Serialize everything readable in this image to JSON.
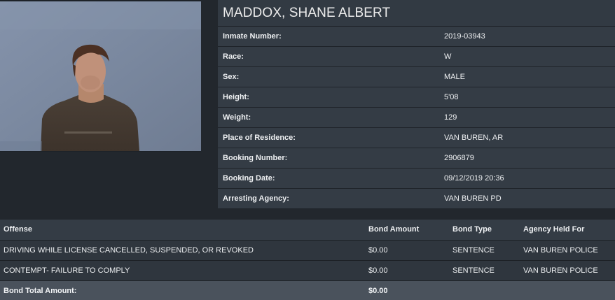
{
  "inmate": {
    "name": "MADDOX, SHANE ALBERT",
    "details": [
      {
        "label": "Inmate Number:",
        "value": "2019-03943"
      },
      {
        "label": "Race:",
        "value": "W"
      },
      {
        "label": "Sex:",
        "value": "MALE"
      },
      {
        "label": "Height:",
        "value": "5'08"
      },
      {
        "label": "Weight:",
        "value": "129"
      },
      {
        "label": "Place of Residence:",
        "value": "VAN BUREN, AR"
      },
      {
        "label": "Booking Number:",
        "value": "2906879"
      },
      {
        "label": "Booking Date:",
        "value": "09/12/2019 20:36"
      },
      {
        "label": "Arresting Agency:",
        "value": "VAN BUREN PD"
      }
    ]
  },
  "offenses": {
    "headers": [
      "Offense",
      "Bond Amount",
      "Bond Type",
      "Agency Held For"
    ],
    "rows": [
      [
        "DRIVING WHILE LICENSE CANCELLED, SUSPENDED, OR REVOKED",
        "$0.00",
        "SENTENCE",
        "VAN BUREN POLICE"
      ],
      [
        "CONTEMPT- FAILURE TO COMPLY",
        "$0.00",
        "SENTENCE",
        "VAN BUREN POLICE"
      ]
    ],
    "total_label": "Bond Total Amount:",
    "total_value": "$0.00"
  }
}
